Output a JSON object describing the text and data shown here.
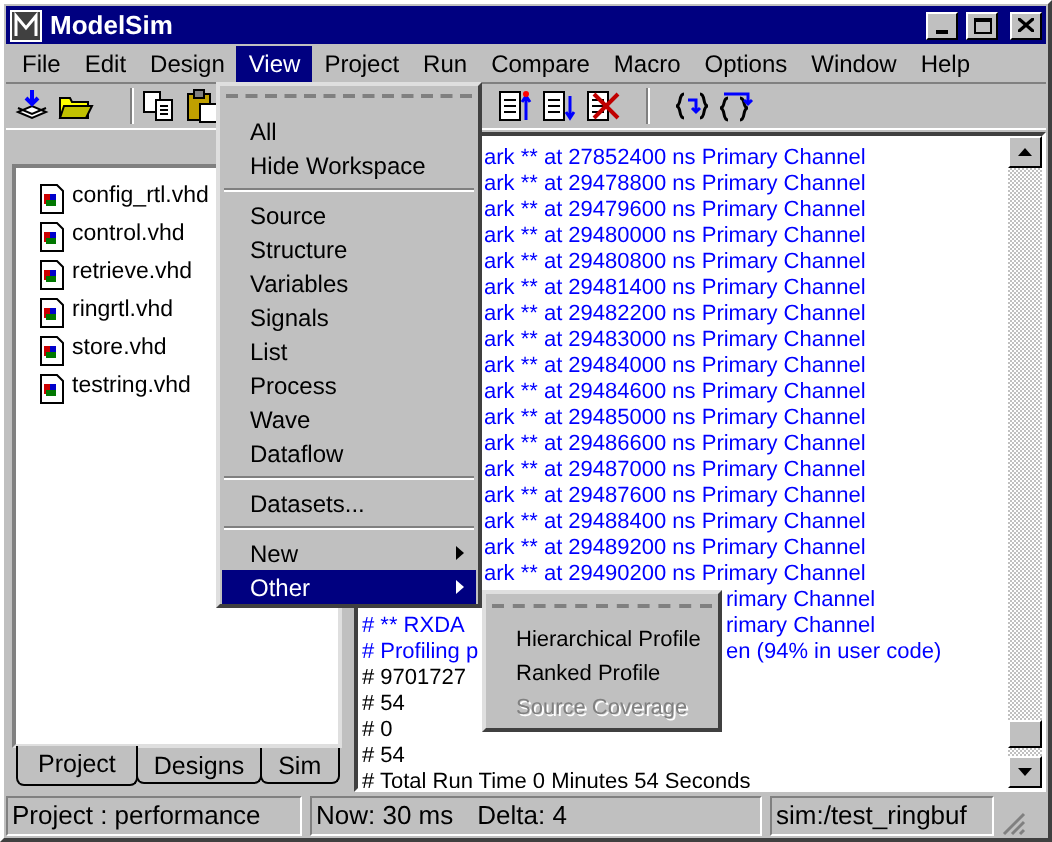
{
  "window": {
    "title": "ModelSim"
  },
  "menu_bar": [
    {
      "label": "File",
      "selected": false
    },
    {
      "label": "Edit",
      "selected": false
    },
    {
      "label": "Design",
      "selected": false
    },
    {
      "label": "View",
      "selected": true
    },
    {
      "label": "Project",
      "selected": false
    },
    {
      "label": "Run",
      "selected": false
    },
    {
      "label": "Compare",
      "selected": false
    },
    {
      "label": "Macro",
      "selected": false
    },
    {
      "label": "Options",
      "selected": false
    },
    {
      "label": "Window",
      "selected": false
    },
    {
      "label": "Help",
      "selected": false
    }
  ],
  "view_menu": {
    "items": [
      {
        "kind": "tearoff"
      },
      {
        "kind": "item",
        "label": "All",
        "selected": false
      },
      {
        "kind": "item",
        "label": "Hide Workspace",
        "selected": false
      },
      {
        "kind": "separator"
      },
      {
        "kind": "item",
        "label": "Source",
        "selected": false
      },
      {
        "kind": "item",
        "label": "Structure",
        "selected": false
      },
      {
        "kind": "item",
        "label": "Variables",
        "selected": false
      },
      {
        "kind": "item",
        "label": "Signals",
        "selected": false
      },
      {
        "kind": "item",
        "label": "List",
        "selected": false
      },
      {
        "kind": "item",
        "label": "Process",
        "selected": false
      },
      {
        "kind": "item",
        "label": "Wave",
        "selected": false
      },
      {
        "kind": "item",
        "label": "Dataflow",
        "selected": false
      },
      {
        "kind": "separator"
      },
      {
        "kind": "item",
        "label": "Datasets...",
        "selected": false
      },
      {
        "kind": "separator"
      },
      {
        "kind": "submenu",
        "label": "New",
        "selected": false
      },
      {
        "kind": "submenu",
        "label": "Other",
        "selected": true
      }
    ]
  },
  "other_submenu": {
    "items": [
      {
        "kind": "tearoff"
      },
      {
        "kind": "item",
        "label": "Hierarchical Profile",
        "disabled": false
      },
      {
        "kind": "item",
        "label": "Ranked Profile",
        "disabled": false
      },
      {
        "kind": "item",
        "label": "Source Coverage",
        "disabled": true
      }
    ]
  },
  "workspace": {
    "files": [
      "config_rtl.vhd",
      "control.vhd",
      "retrieve.vhd",
      "ringrtl.vhd",
      "store.vhd",
      "testring.vhd"
    ],
    "tabs": [
      {
        "label": "Project",
        "selected": true
      },
      {
        "label": "Designs",
        "selected": false
      },
      {
        "label": "Sim",
        "selected": false
      }
    ]
  },
  "transcript": {
    "lines": [
      {
        "kind": "after_menu",
        "text": "ark ** at 27852400 ns Primary Channel",
        "color": "#0000ff"
      },
      {
        "kind": "after_menu",
        "text": "ark ** at 29478800 ns Primary Channel",
        "color": "#0000ff"
      },
      {
        "kind": "after_menu",
        "text": "ark ** at 29479600 ns Primary Channel",
        "color": "#0000ff"
      },
      {
        "kind": "after_menu",
        "text": "ark ** at 29480000 ns Primary Channel",
        "color": "#0000ff"
      },
      {
        "kind": "after_menu",
        "text": "ark ** at 29480800 ns Primary Channel",
        "color": "#0000ff"
      },
      {
        "kind": "after_menu",
        "text": "ark ** at 29481400 ns Primary Channel",
        "color": "#0000ff"
      },
      {
        "kind": "after_menu",
        "text": "ark ** at 29482200 ns Primary Channel",
        "color": "#0000ff"
      },
      {
        "kind": "after_menu",
        "text": "ark ** at 29483000 ns Primary Channel",
        "color": "#0000ff"
      },
      {
        "kind": "after_menu",
        "text": "ark ** at 29484000 ns Primary Channel",
        "color": "#0000ff"
      },
      {
        "kind": "after_menu",
        "text": "ark ** at 29484600 ns Primary Channel",
        "color": "#0000ff"
      },
      {
        "kind": "after_menu",
        "text": "ark ** at 29485000 ns Primary Channel",
        "color": "#0000ff"
      },
      {
        "kind": "after_menu",
        "text": "ark ** at 29486600 ns Primary Channel",
        "color": "#0000ff"
      },
      {
        "kind": "after_menu",
        "text": "ark ** at 29487000 ns Primary Channel",
        "color": "#0000ff"
      },
      {
        "kind": "after_menu",
        "text": "ark ** at 29487600 ns Primary Channel",
        "color": "#0000ff"
      },
      {
        "kind": "after_menu",
        "text": "ark ** at 29488400 ns Primary Channel",
        "color": "#0000ff"
      },
      {
        "kind": "after_menu",
        "text": "ark ** at 29489200 ns Primary Channel",
        "color": "#0000ff"
      },
      {
        "kind": "after_menu",
        "text": "ark ** at 29490200 ns Primary Channel",
        "color": "#0000ff"
      },
      {
        "kind": "right",
        "right": "rimary Channel",
        "color": "#0000ff"
      },
      {
        "kind": "split",
        "text": "# ** RXDA",
        "right": "rimary Channel",
        "color": "#0000ff"
      },
      {
        "kind": "split",
        "text": "# Profiling p",
        "right": "en (94% in user code)",
        "color": "#0000ff"
      },
      {
        "kind": "full",
        "text": "# 9701727",
        "color": "#000000"
      },
      {
        "kind": "full",
        "text": "# 54",
        "color": "#000000"
      },
      {
        "kind": "full",
        "text": "# 0",
        "color": "#000000"
      },
      {
        "kind": "full",
        "text": "# 54",
        "color": "#000000"
      },
      {
        "kind": "full",
        "text": "# Total Run Time  0  Minutes  54  Seconds",
        "color": "#000000"
      }
    ]
  },
  "status_bar": {
    "project": "Project : performance",
    "now": "Now: 30 ms",
    "delta": "Delta: 4",
    "context": "sim:/test_ringbuf"
  }
}
